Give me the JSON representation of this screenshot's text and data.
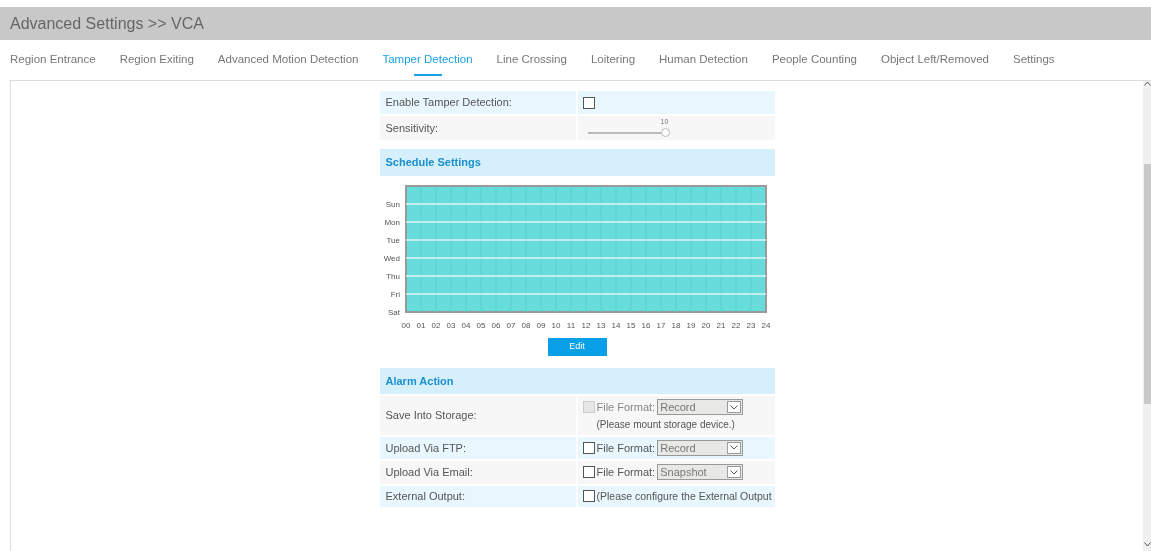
{
  "header": {
    "title": "Advanced Settings >> VCA"
  },
  "tabs": [
    {
      "label": "Region Entrance",
      "selected": false
    },
    {
      "label": "Region Exiting",
      "selected": false
    },
    {
      "label": "Advanced Motion Detection",
      "selected": false
    },
    {
      "label": "Tamper Detection",
      "selected": true
    },
    {
      "label": "Line Crossing",
      "selected": false
    },
    {
      "label": "Loitering",
      "selected": false
    },
    {
      "label": "Human Detection",
      "selected": false
    },
    {
      "label": "People Counting",
      "selected": false
    },
    {
      "label": "Object Left/Removed",
      "selected": false
    },
    {
      "label": "Settings",
      "selected": false
    }
  ],
  "enable": {
    "label": "Enable Tamper Detection:",
    "checked": false
  },
  "sensitivity": {
    "label": "Sensitivity:",
    "reading": "10",
    "level": 1
  },
  "schedule": {
    "title": "Schedule Settings",
    "days": [
      "Sun",
      "Mon",
      "Tue",
      "Wed",
      "Thu",
      "Fri",
      "Sat"
    ],
    "hours": [
      "00",
      "01",
      "02",
      "03",
      "04",
      "05",
      "06",
      "07",
      "08",
      "09",
      "10",
      "11",
      "12",
      "13",
      "14",
      "15",
      "16",
      "17",
      "18",
      "19",
      "20",
      "21",
      "22",
      "23",
      "24"
    ],
    "edit_button": "Edit"
  },
  "alarm_action": {
    "title": "Alarm Action",
    "rows": [
      {
        "label": "Save Into Storage:",
        "kind": "format",
        "checked": false,
        "disabled": true,
        "format_label": "File Format:",
        "format": "Record",
        "note": "(Please mount storage device.)"
      },
      {
        "label": "Upload Via FTP:",
        "kind": "format",
        "checked": false,
        "disabled": false,
        "format_label": "File Format:",
        "format": "Record"
      },
      {
        "label": "Upload Via Email:",
        "kind": "format",
        "checked": false,
        "disabled": false,
        "format_label": "File Format:",
        "format": "Snapshot"
      },
      {
        "label": "External Output:",
        "kind": "note",
        "checked": false,
        "disabled": false,
        "note": "(Please configure the External Output"
      }
    ]
  }
}
